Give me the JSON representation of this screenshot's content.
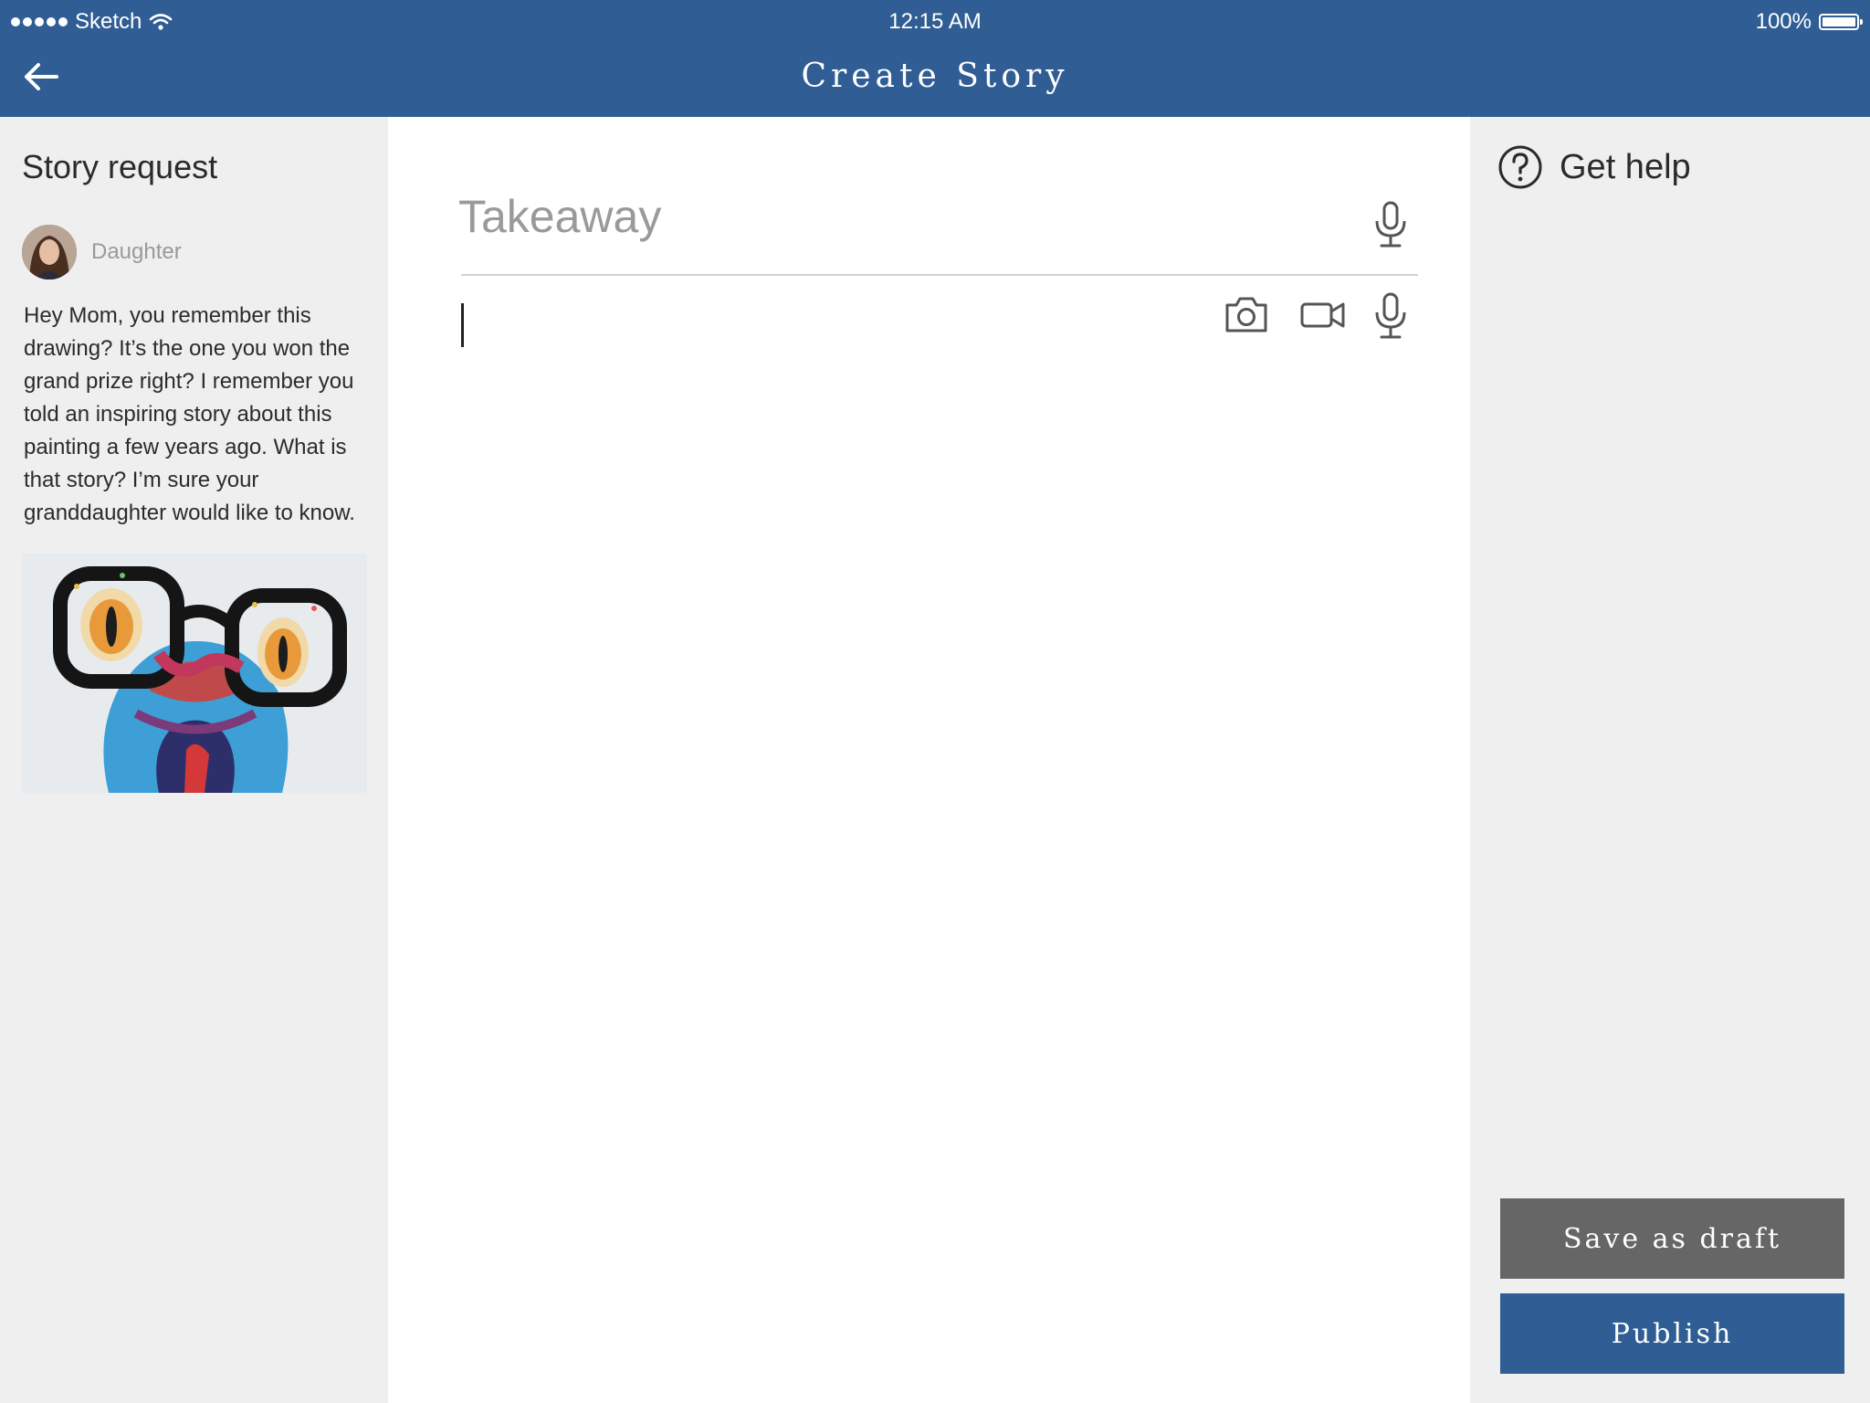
{
  "status_bar": {
    "carrier": "Sketch",
    "time": "12:15 AM",
    "battery": "100%"
  },
  "nav": {
    "title": "Create Story"
  },
  "request": {
    "title": "Story request",
    "requester": "Daughter",
    "message": "Hey Mom, you remember this drawing? It’s the one you won the grand prize right? I remember you told an inspiring story about this painting a few years ago. What is that story? I’m sure your granddaughter would like to know."
  },
  "editor": {
    "takeaway_placeholder": "Takeaway"
  },
  "help": {
    "label": "Get help"
  },
  "actions": {
    "save_draft": "Save as draft",
    "publish": "Publish"
  },
  "colors": {
    "brand": "#2f5d94",
    "secondary_button": "#666666",
    "panel_bg": "#efefef"
  }
}
